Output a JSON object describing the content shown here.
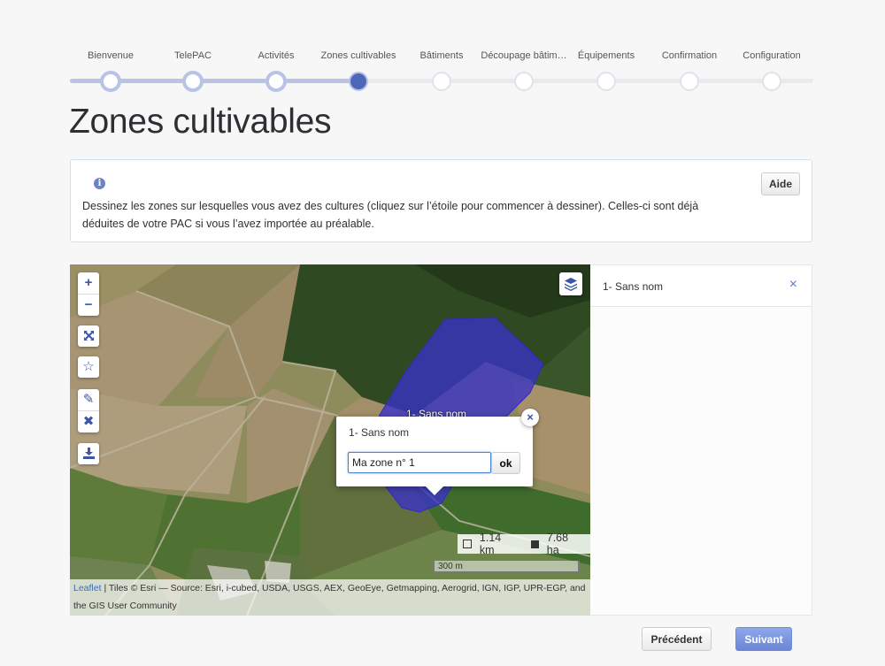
{
  "stepper": {
    "steps": [
      {
        "label": "Bienvenue",
        "state": "done"
      },
      {
        "label": "TelePAC",
        "state": "done"
      },
      {
        "label": "Activités",
        "state": "done"
      },
      {
        "label": "Zones cultivables",
        "state": "current"
      },
      {
        "label": "Bâtiments",
        "state": "todo"
      },
      {
        "label": "Découpage bâtim…",
        "state": "todo"
      },
      {
        "label": "Équipements",
        "state": "todo"
      },
      {
        "label": "Confirmation",
        "state": "todo"
      },
      {
        "label": "Configuration",
        "state": "todo"
      }
    ]
  },
  "page": {
    "title": "Zones cultivables"
  },
  "info": {
    "icon": "info-icon",
    "text": "Dessinez les zones sur lesquelles vous avez des cultures (cliquez sur l’étoile pour commencer à dessiner). Celles-ci sont déjà déduites de votre PAC si vous l’avez importée au préalable.",
    "help_label": "Aide"
  },
  "map": {
    "controls": {
      "zoom_in": "+",
      "zoom_out": "−",
      "fullscreen_icon": "expand-icon",
      "draw_icon": "star-icon",
      "edit_icon": "pencil-icon",
      "delete_icon": "x-icon",
      "download_icon": "download-icon",
      "layers_icon": "layers-icon"
    },
    "polygon_label": "1- Sans nom",
    "polygon_color": "#3a32c8",
    "popup": {
      "title": "1- Sans nom",
      "input_value": "Ma zone n° 1",
      "ok_label": "ok",
      "close": "×"
    },
    "measure": {
      "perimeter": "1.14 km",
      "area": "7.68 ha"
    },
    "scale": "300 m",
    "attribution": {
      "link": "Leaflet",
      "text": " | Tiles © Esri — Source: Esri, i-cubed, USDA, USGS, AEX, GeoEye, Getmapping, Aerogrid, IGN, IGP, UPR-EGP, and the GIS User Community"
    }
  },
  "zones": [
    {
      "name": "1- Sans nom",
      "delete": "×"
    }
  ],
  "footer": {
    "prev_label": "Précédent",
    "next_label": "Suivant"
  },
  "colors": {
    "accent": "#4f67b8",
    "primary_button": "#7890dd",
    "progress": "#b9c3e6"
  }
}
